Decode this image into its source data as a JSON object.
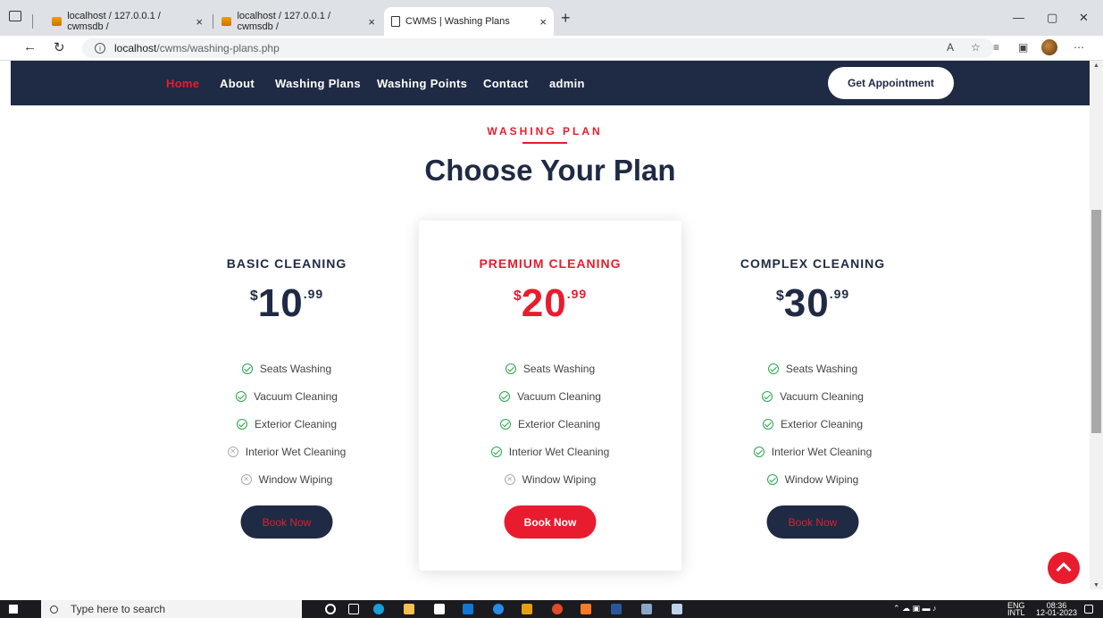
{
  "browser": {
    "tabs": [
      {
        "label": "localhost / 127.0.0.1 / cwmsdb /",
        "favicon": "phpmyadmin-icon"
      },
      {
        "label": "localhost / 127.0.0.1 / cwmsdb /",
        "favicon": "phpmyadmin-icon"
      },
      {
        "label": "CWMS | Washing Plans",
        "favicon": "page-icon"
      }
    ],
    "tab_close": "×",
    "new_tab": "+",
    "address": {
      "host": "localhost",
      "path": "/cwms/washing-plans.php",
      "info": "i"
    },
    "window": {
      "minimize": "—",
      "restore": "▢",
      "close": "✕"
    }
  },
  "site": {
    "nav": [
      {
        "label": "Home",
        "active": true
      },
      {
        "label": "About"
      },
      {
        "label": "Washing Plans"
      },
      {
        "label": "Washing Points"
      },
      {
        "label": "Contact"
      },
      {
        "label": "admin"
      }
    ],
    "cta": "Get Appointment",
    "section": {
      "eyebrow": "WASHING PLAN",
      "title": "Choose Your Plan"
    },
    "plans": [
      {
        "name": "BASIC CLEANING",
        "currency": "$",
        "price_int": "10",
        "price_dec": ".99",
        "features": [
          {
            "label": "Seats Washing",
            "included": true
          },
          {
            "label": "Vacuum Cleaning",
            "included": true
          },
          {
            "label": "Exterior Cleaning",
            "included": true
          },
          {
            "label": "Interior Wet Cleaning",
            "included": false
          },
          {
            "label": "Window Wiping",
            "included": false
          }
        ],
        "button": "Book Now"
      },
      {
        "name": "PREMIUM CLEANING",
        "currency": "$",
        "price_int": "20",
        "price_dec": ".99",
        "features": [
          {
            "label": "Seats Washing",
            "included": true
          },
          {
            "label": "Vacuum Cleaning",
            "included": true
          },
          {
            "label": "Exterior Cleaning",
            "included": true
          },
          {
            "label": "Interior Wet Cleaning",
            "included": true
          },
          {
            "label": "Window Wiping",
            "included": false
          }
        ],
        "button": "Book Now"
      },
      {
        "name": "COMPLEX CLEANING",
        "currency": "$",
        "price_int": "30",
        "price_dec": ".99",
        "features": [
          {
            "label": "Seats Washing",
            "included": true
          },
          {
            "label": "Vacuum Cleaning",
            "included": true
          },
          {
            "label": "Exterior Cleaning",
            "included": true
          },
          {
            "label": "Interior Wet Cleaning",
            "included": true
          },
          {
            "label": "Window Wiping",
            "included": true
          }
        ],
        "button": "Book Now"
      }
    ]
  },
  "taskbar": {
    "search_placeholder": "Type here to search",
    "lang": "ENG",
    "lang_sub": "INTL",
    "time": "08:36",
    "date": "12-01-2023"
  },
  "colors": {
    "navy": "#1f2a44",
    "accent_red": "#e81c2e",
    "check_green": "#2ca54d"
  }
}
